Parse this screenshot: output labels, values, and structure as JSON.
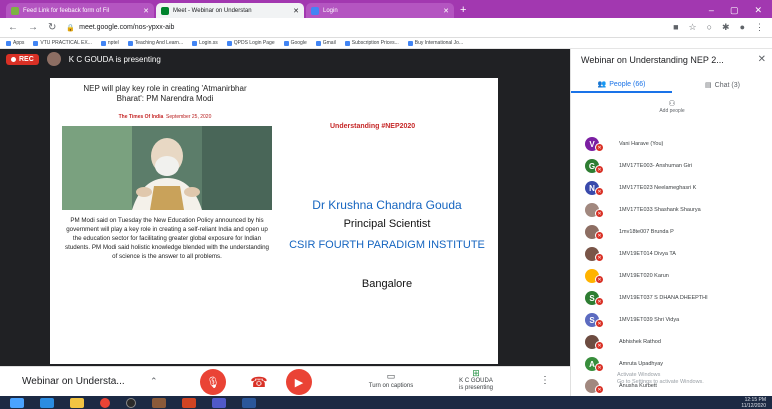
{
  "browser": {
    "tabs": [
      {
        "title": "Feed Link for feeback form of Fil",
        "color": "#7cb342",
        "active": false
      },
      {
        "title": "Meet - Webinar on Understan",
        "color": "#00832d",
        "active": true
      },
      {
        "title": "Login",
        "color": "#4285f4",
        "active": false
      }
    ],
    "url": "meet.google.com/nos-ypxx-aib",
    "bookmarks": [
      "Apps",
      "VTU PRACTICAL EX...",
      "nptel",
      "Teaching And Learn...",
      "Login.ss",
      "QPDS Login Page",
      "Google",
      "Gmail",
      "Subscription Prices...",
      "Buy International Jo..."
    ]
  },
  "meet": {
    "rec_label": "REC",
    "presenting_text": "K C GOUDA is presenting",
    "meeting_title": "Webinar on Understa...",
    "captions_label": "Turn on captions",
    "present_label_1": "K C GOUDA",
    "present_label_2": "is presenting"
  },
  "slide": {
    "headline": "NEP will play key role in creating 'Atmanirbhar Bharat': PM Narendra Modi",
    "source": "The Times Of India",
    "date": "September 25, 2020",
    "body": "PM Modi said on Tuesday the New Education Policy announced by his government will play a key role in creating a self-reliant India and open up the education sector for facilitating greater global exposure for Indian students. PM Modi said holistic knowledge blended with the understanding of science is the answer to all problems.",
    "tag": "Understanding #NEP2020",
    "speaker": "Dr Krushna Chandra Gouda",
    "role": "Principal Scientist",
    "institute": "CSIR FOURTH PARADIGM INSTITUTE",
    "city": "Bangalore"
  },
  "panel": {
    "title": "Webinar on Understanding NEP 2...",
    "people_tab": "People (66)",
    "chat_tab": "Chat (3)",
    "add_people": "Add people",
    "participants": [
      {
        "initial": "V",
        "name": "Vani Harave (You)",
        "color": "#7b1fa2"
      },
      {
        "initial": "G",
        "name": "1MV17TE003- Anshuman Giri",
        "color": "#2e7d32"
      },
      {
        "initial": "N",
        "name": "1MV17TE023 Neelameghasri K",
        "color": "#3949ab"
      },
      {
        "initial": "",
        "name": "1MV17TE033 Shashank Shaurya",
        "color": "#a1887f"
      },
      {
        "initial": "",
        "name": "1mv18te007 Brunda P",
        "color": "#8d6e63"
      },
      {
        "initial": "",
        "name": "1MV19ET014 Divya TA",
        "color": "#795548"
      },
      {
        "initial": "",
        "name": "1MV19ET020 Karun",
        "color": "#ffb300"
      },
      {
        "initial": "S",
        "name": "1MV19ET037 S DHANA DHEEPTHI",
        "color": "#2e7d32"
      },
      {
        "initial": "S",
        "name": "1MV19ET039 Shri Vidya",
        "color": "#5c6bc0"
      },
      {
        "initial": "",
        "name": "Abhishek Rathod",
        "color": "#6d4c41"
      },
      {
        "initial": "A",
        "name": "Amruta Upadhyay",
        "color": "#388e3c"
      },
      {
        "initial": "",
        "name": "Anusha Kurbett",
        "color": "#a1887f"
      }
    ],
    "watermark_1": "Activate Windows",
    "watermark_2": "Go to Settings to activate Windows."
  },
  "taskbar": {
    "time": "12:15 PM",
    "date": "11/12/2020"
  }
}
